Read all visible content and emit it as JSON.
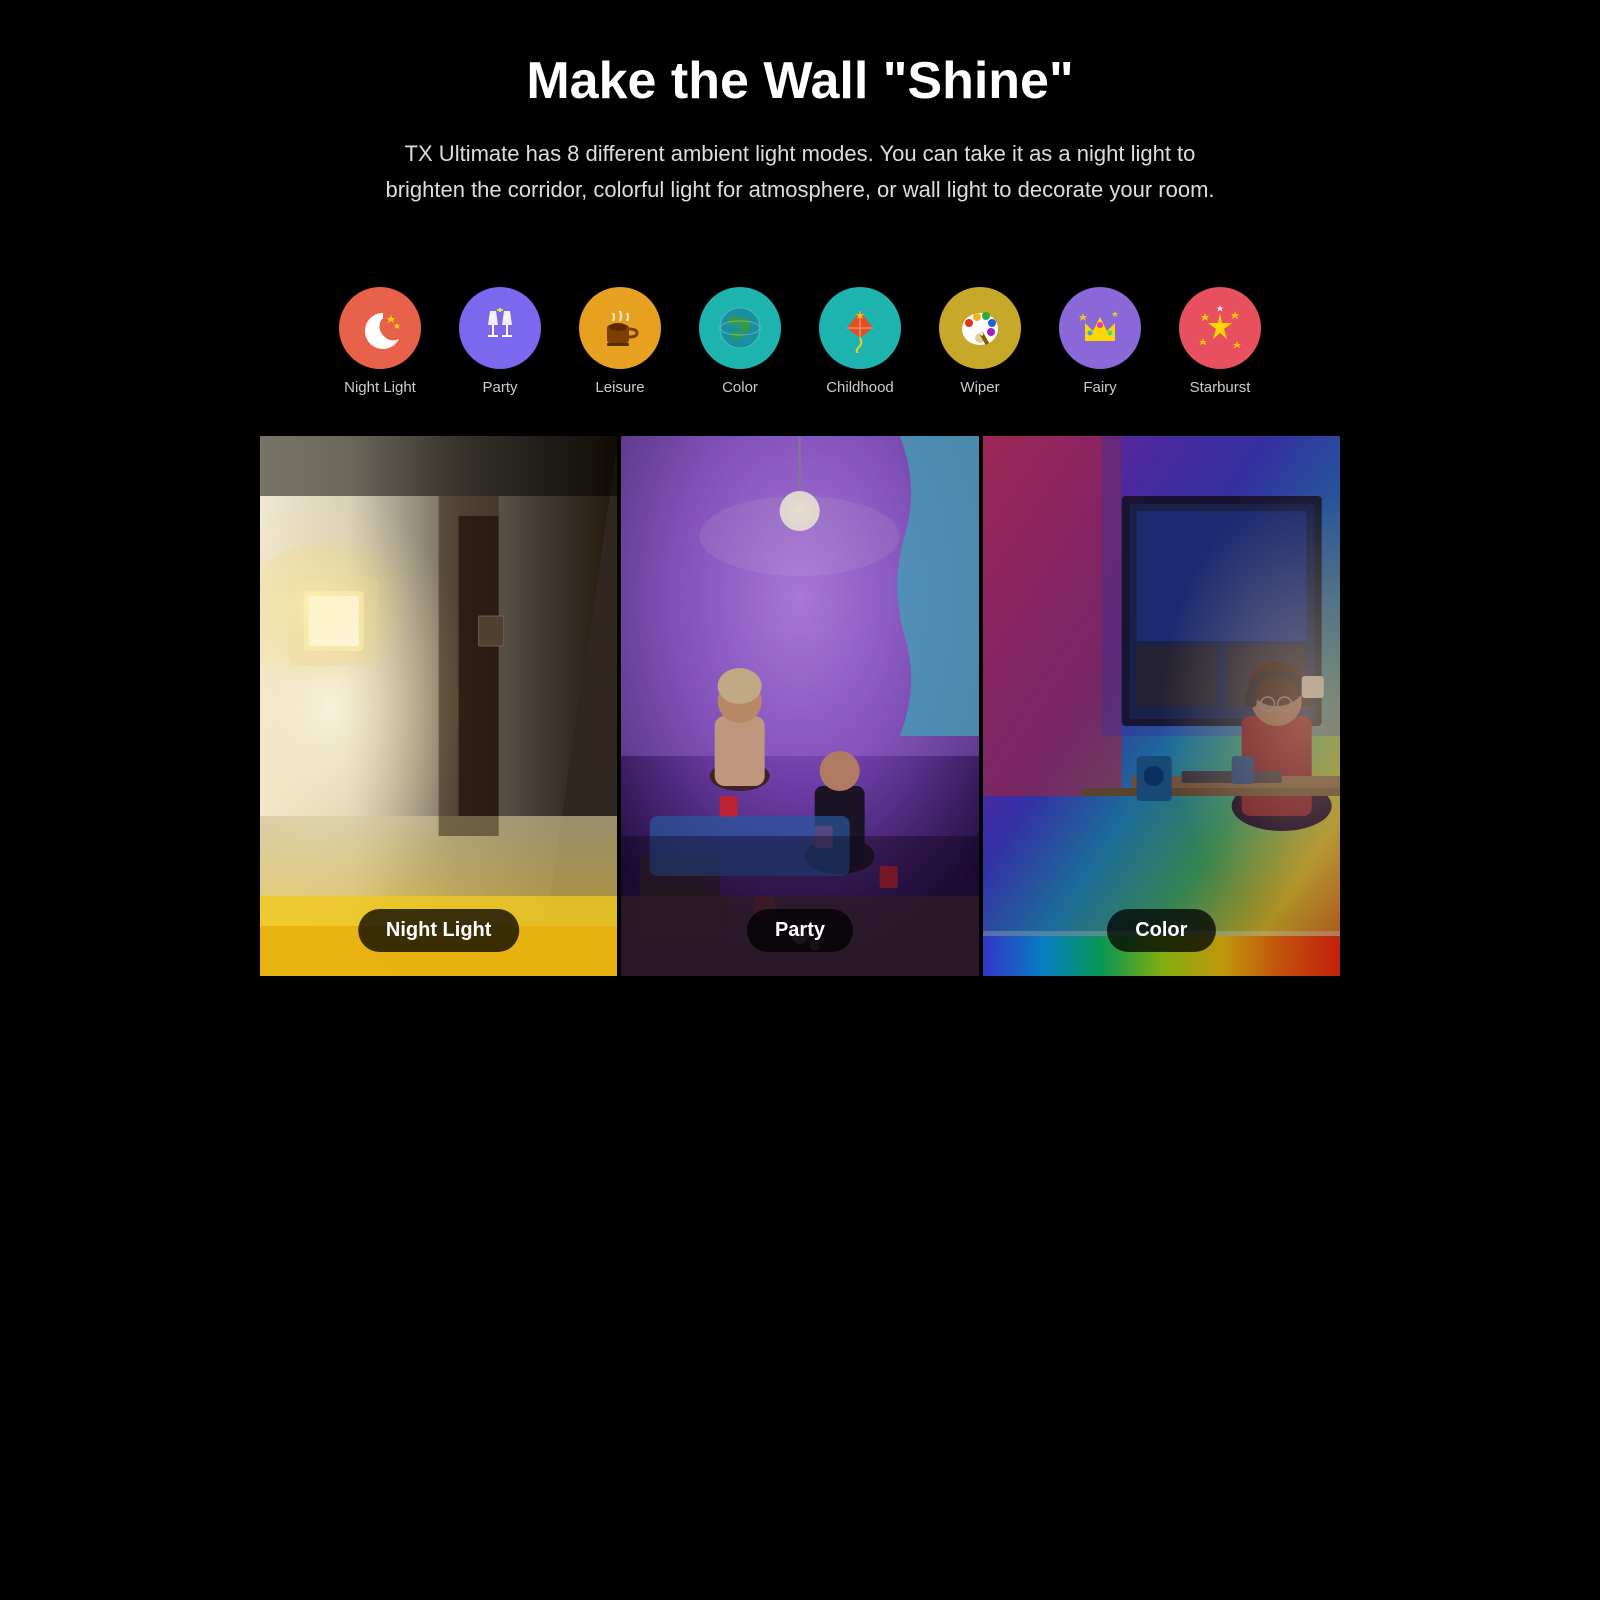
{
  "header": {
    "title": "Make the Wall \"Shine\"",
    "subtitle": "TX Ultimate has 8 different ambient light modes. You can take it as a night light to brighten the corridor, colorful light for atmosphere, or wall light to decorate your room."
  },
  "modes": [
    {
      "id": "night-light",
      "label": "Night Light",
      "icon_class": "icon-night",
      "emoji": "🌙"
    },
    {
      "id": "party",
      "label": "Party",
      "icon_class": "icon-party",
      "emoji": "🥂"
    },
    {
      "id": "leisure",
      "label": "Leisure",
      "icon_class": "icon-leisure",
      "emoji": "☕"
    },
    {
      "id": "color",
      "label": "Color",
      "icon_class": "icon-color",
      "emoji": "🌍"
    },
    {
      "id": "childhood",
      "label": "Childhood",
      "icon_class": "icon-childhood",
      "emoji": "🪁"
    },
    {
      "id": "wiper",
      "label": "Wiper",
      "icon_class": "icon-wiper",
      "emoji": "🎨"
    },
    {
      "id": "fairy",
      "label": "Fairy",
      "icon_class": "icon-fairy",
      "emoji": "👑"
    },
    {
      "id": "starburst",
      "label": "Starburst",
      "icon_class": "icon-starburst",
      "emoji": "✨"
    }
  ],
  "photos": [
    {
      "id": "photo-night-light",
      "label": "Night Light",
      "type": "night"
    },
    {
      "id": "photo-party",
      "label": "Party",
      "type": "party"
    },
    {
      "id": "photo-color",
      "label": "Color",
      "type": "color"
    }
  ]
}
